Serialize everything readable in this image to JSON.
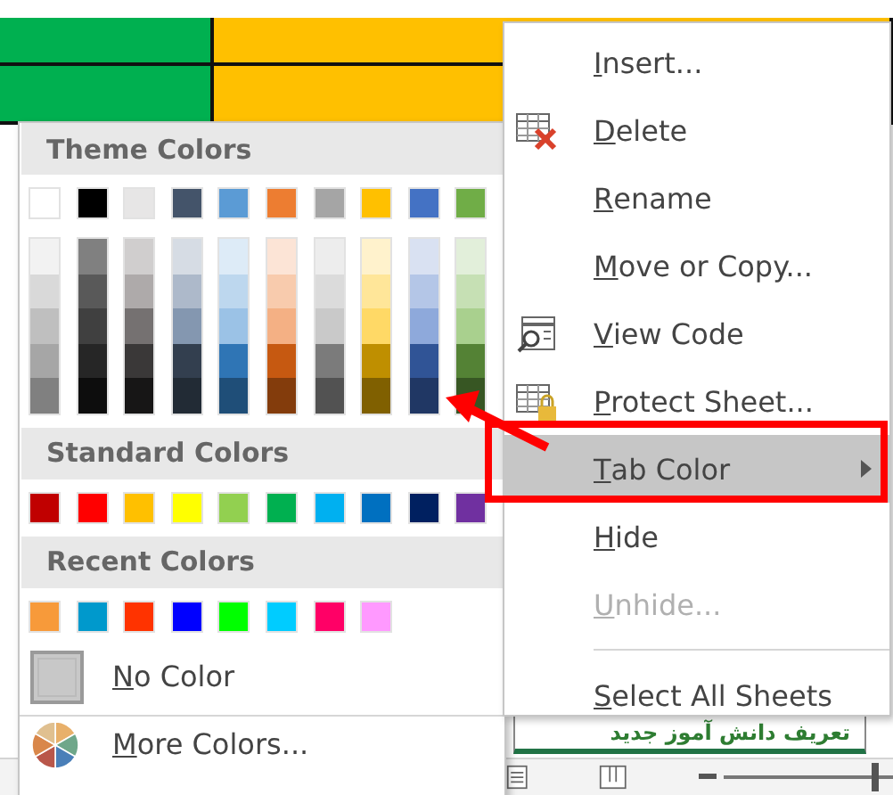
{
  "sheet_tab": {
    "label": "تعریف دانش آموز جدید"
  },
  "zoom_slider": {
    "level": 0.92
  },
  "color_menu": {
    "sections": [
      {
        "kind": "theme",
        "title": "Theme Colors",
        "swatches": [
          {
            "color": "#ffffff"
          },
          {
            "color": "#000000"
          },
          {
            "color": "#e7e6e6"
          },
          {
            "color": "#44546a"
          },
          {
            "color": "#5b9bd5"
          },
          {
            "color": "#ed7d31"
          },
          {
            "color": "#a5a5a5"
          },
          {
            "color": "#ffc000"
          },
          {
            "color": "#4472c4"
          },
          {
            "color": "#70ad47"
          }
        ],
        "shades": [
          {
            "colors": [
              {
                "color": "#f2f2f2"
              },
              {
                "color": "#d9d9d9"
              },
              {
                "color": "#bfbfbf"
              },
              {
                "color": "#a6a6a6"
              },
              {
                "color": "#808080"
              }
            ]
          },
          {
            "colors": [
              {
                "color": "#808080"
              },
              {
                "color": "#595959"
              },
              {
                "color": "#404040"
              },
              {
                "color": "#262626"
              },
              {
                "color": "#0d0d0d"
              }
            ]
          },
          {
            "colors": [
              {
                "color": "#d0cece"
              },
              {
                "color": "#aeaaaa"
              },
              {
                "color": "#757171"
              },
              {
                "color": "#3a3838"
              },
              {
                "color": "#171616"
              }
            ]
          },
          {
            "colors": [
              {
                "color": "#d6dce4"
              },
              {
                "color": "#adb9ca"
              },
              {
                "color": "#8497b0"
              },
              {
                "color": "#333f4f"
              },
              {
                "color": "#222b35"
              }
            ]
          },
          {
            "colors": [
              {
                "color": "#ddebf7"
              },
              {
                "color": "#bdd7ee"
              },
              {
                "color": "#9bc2e6"
              },
              {
                "color": "#2f75b5"
              },
              {
                "color": "#1f4e78"
              }
            ]
          },
          {
            "colors": [
              {
                "color": "#fce4d6"
              },
              {
                "color": "#f8cbad"
              },
              {
                "color": "#f4b084"
              },
              {
                "color": "#c65911"
              },
              {
                "color": "#833c0c"
              }
            ]
          },
          {
            "colors": [
              {
                "color": "#ededed"
              },
              {
                "color": "#dbdbdb"
              },
              {
                "color": "#c9c9c9"
              },
              {
                "color": "#7b7b7b"
              },
              {
                "color": "#525252"
              }
            ]
          },
          {
            "colors": [
              {
                "color": "#fff2cc"
              },
              {
                "color": "#ffe699"
              },
              {
                "color": "#ffd966"
              },
              {
                "color": "#bf8f00"
              },
              {
                "color": "#806000"
              }
            ]
          },
          {
            "colors": [
              {
                "color": "#d9e1f2"
              },
              {
                "color": "#b4c6e7"
              },
              {
                "color": "#8ea9db"
              },
              {
                "color": "#305496"
              },
              {
                "color": "#203764"
              }
            ]
          },
          {
            "colors": [
              {
                "color": "#e2efda"
              },
              {
                "color": "#c6e0b4"
              },
              {
                "color": "#a9d08e"
              },
              {
                "color": "#548235"
              },
              {
                "color": "#375623"
              }
            ]
          }
        ]
      },
      {
        "kind": "standard",
        "title": "Standard Colors",
        "swatches": [
          {
            "color": "#c00000"
          },
          {
            "color": "#ff0000"
          },
          {
            "color": "#ffc000"
          },
          {
            "color": "#ffff00"
          },
          {
            "color": "#92d050"
          },
          {
            "color": "#00b050"
          },
          {
            "color": "#00b0f0"
          },
          {
            "color": "#0070c0"
          },
          {
            "color": "#002060"
          },
          {
            "color": "#7030a0"
          }
        ]
      },
      {
        "kind": "recent",
        "title": "Recent Colors",
        "swatches": [
          {
            "color": "#f79a3a"
          },
          {
            "color": "#0099cc"
          },
          {
            "color": "#ff3300"
          },
          {
            "color": "#0000ff"
          },
          {
            "color": "#00ff00"
          },
          {
            "color": "#00ccff"
          },
          {
            "color": "#ff0066"
          },
          {
            "color": "#ff99ff"
          }
        ]
      }
    ],
    "actions": [
      {
        "kind": "no-color",
        "label": "No Color",
        "mnemonic": true
      },
      {
        "kind": "more-colors",
        "label": "More Colors...",
        "mnemonic": true
      }
    ]
  },
  "context_menu": {
    "items": [
      {
        "kind": "plain",
        "label": "Insert...",
        "mnemonic": true,
        "disabled": false,
        "selected": false
      },
      {
        "kind": "delete",
        "label": "Delete",
        "mnemonic": true,
        "disabled": false,
        "selected": false
      },
      {
        "kind": "plain",
        "label": "Rename",
        "mnemonic": true,
        "disabled": false,
        "selected": false
      },
      {
        "kind": "plain",
        "label": "Move or Copy...",
        "mnemonic": true,
        "disabled": false,
        "selected": false
      },
      {
        "kind": "view-code",
        "label": "View Code",
        "mnemonic": true,
        "disabled": false,
        "selected": false
      },
      {
        "kind": "protect",
        "label": "Protect Sheet...",
        "mnemonic": true,
        "disabled": false,
        "selected": false
      },
      {
        "kind": "submenu",
        "label": "Tab Color",
        "mnemonic": true,
        "disabled": false,
        "selected": true
      },
      {
        "kind": "plain",
        "label": "Hide",
        "mnemonic": true,
        "disabled": false,
        "selected": false
      },
      {
        "kind": "plain",
        "label": "Unhide...",
        "mnemonic": true,
        "disabled": true,
        "selected": false
      },
      {
        "kind": "separator"
      },
      {
        "kind": "plain",
        "label": "Select All Sheets",
        "mnemonic": true,
        "disabled": false,
        "selected": false
      }
    ]
  }
}
